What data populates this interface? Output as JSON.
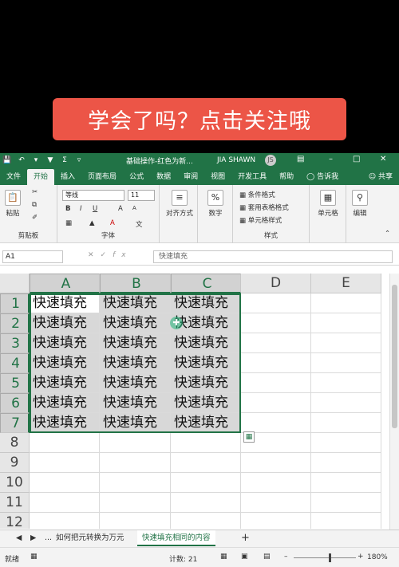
{
  "banner": {
    "text": "学会了吗？点击关注哦"
  },
  "window": {
    "title": "基础操作-红色为新...",
    "user": "JIA SHAWN",
    "avatar": "JS",
    "accent": "#217346"
  },
  "tabs": [
    "文件",
    "开始",
    "插入",
    "页面布局",
    "公式",
    "数据",
    "审阅",
    "视图",
    "开发工具",
    "帮助"
  ],
  "tell_me": "告诉我",
  "share": "共享",
  "ribbon": {
    "clipboard": {
      "paste": "粘贴",
      "label": "剪贴板"
    },
    "font": {
      "name": "等线",
      "size": "11",
      "bold": "B",
      "italic": "I",
      "underline": "U",
      "grow": "A",
      "shrink": "A",
      "color_a": "A",
      "label": "字体"
    },
    "alignment": {
      "label": "对齐方式"
    },
    "number": {
      "symbol": "%",
      "label": "数字"
    },
    "styles": {
      "conditional": "条件格式",
      "table": "套用表格格式",
      "cell": "单元格样式",
      "label": "样式"
    },
    "cells": {
      "label": "单元格"
    },
    "editing": {
      "label": "编辑"
    }
  },
  "formula_bar": {
    "name_box": "A1",
    "fx": "fx",
    "value": "快速填充"
  },
  "columns": [
    "A",
    "B",
    "C",
    "D",
    "E"
  ],
  "rows": [
    "1",
    "2",
    "3",
    "4",
    "5",
    "6",
    "7",
    "8",
    "9",
    "10",
    "11",
    "12"
  ],
  "cells": [
    [
      "快速填充",
      "快速填充",
      "快速填充"
    ],
    [
      "快速填充",
      "快速填充",
      "快速填充"
    ],
    [
      "快速填充",
      "快速填充",
      "快速填充"
    ],
    [
      "快速填充",
      "快速填充",
      "快速填充"
    ],
    [
      "快速填充",
      "快速填充",
      "快速填充"
    ],
    [
      "快速填充",
      "快速填充",
      "快速填充"
    ],
    [
      "快速填充",
      "快速填充",
      "快速填充"
    ]
  ],
  "sheets": {
    "more": "...",
    "tab1": "如何把元转换为万元",
    "tab2": "快速填充相同的内容",
    "add": "+"
  },
  "status": {
    "ready": "就绪",
    "count": "计数: 21",
    "zoom": "180%"
  }
}
